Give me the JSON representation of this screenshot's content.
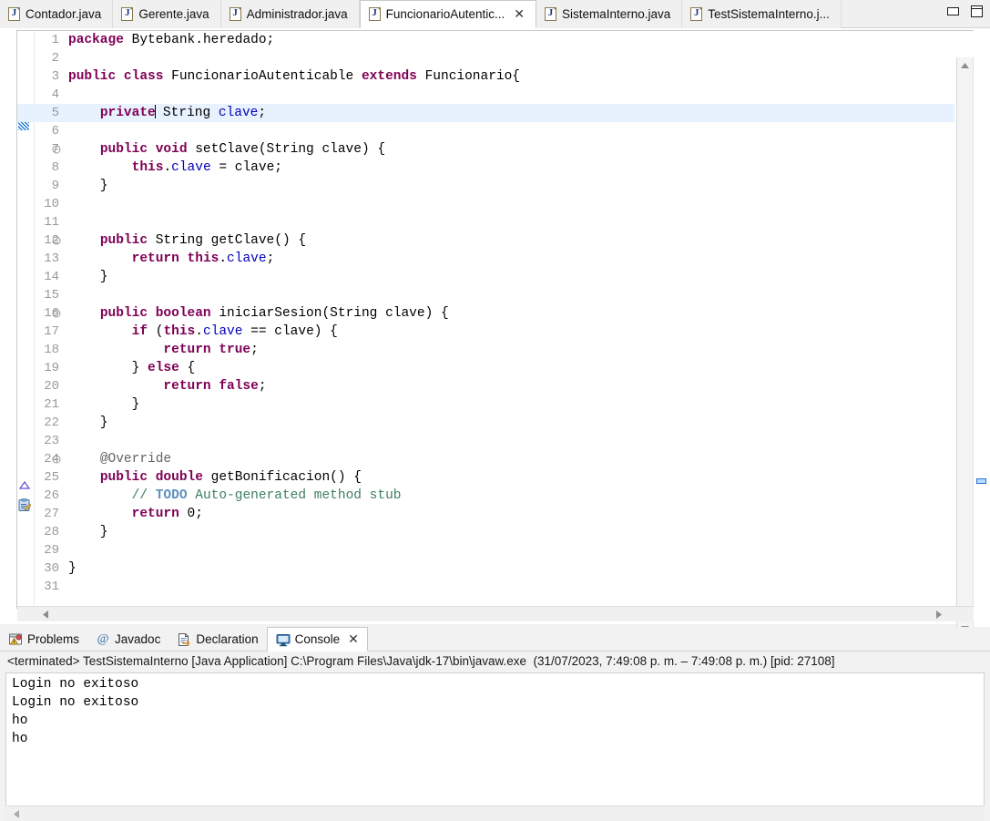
{
  "window": {
    "minimize_label": "minimize",
    "maximize_label": "maximize"
  },
  "editor_tabs": [
    {
      "label": "Contador.java",
      "icon": "java-file-icon",
      "active": false,
      "closable": false
    },
    {
      "label": "Gerente.java",
      "icon": "java-file-icon",
      "active": false,
      "closable": false
    },
    {
      "label": "Administrador.java",
      "icon": "java-file-icon",
      "active": false,
      "closable": false
    },
    {
      "label": "FuncionarioAutentic...",
      "icon": "java-file-icon",
      "active": true,
      "closable": true,
      "close_label": "✕"
    },
    {
      "label": "SistemaInterno.java",
      "icon": "java-file-icon",
      "active": false,
      "closable": false
    },
    {
      "label": "TestSistemaInterno.j...",
      "icon": "java-file-icon",
      "active": false,
      "closable": false
    }
  ],
  "editor": {
    "filename": "FuncionarioAutenticable.java",
    "language": "java",
    "cursor_line": 5,
    "highlighted_line": 5,
    "fold_lines": [
      7,
      12,
      16,
      24
    ],
    "override_marker_line": 25,
    "task_marker_line": 26,
    "changed_marker_line": 5,
    "lines": [
      {
        "n": "1",
        "tokens": [
          {
            "t": "package ",
            "c": "kw"
          },
          {
            "t": "Bytebank.heredado;",
            "c": "plain"
          }
        ]
      },
      {
        "n": "2",
        "tokens": []
      },
      {
        "n": "3",
        "tokens": [
          {
            "t": "public class ",
            "c": "kw"
          },
          {
            "t": "FuncionarioAutenticable ",
            "c": "plain"
          },
          {
            "t": "extends ",
            "c": "kw"
          },
          {
            "t": "Funcionario{",
            "c": "plain"
          }
        ]
      },
      {
        "n": "4",
        "tokens": []
      },
      {
        "n": "5",
        "tokens": [
          {
            "t": "    ",
            "c": "plain"
          },
          {
            "t": "private",
            "c": "kw"
          },
          {
            "t": "CARET",
            "c": "caret"
          },
          {
            "t": " String ",
            "c": "plain"
          },
          {
            "t": "clave",
            "c": "fld"
          },
          {
            "t": ";",
            "c": "plain"
          }
        ]
      },
      {
        "n": "6",
        "tokens": []
      },
      {
        "n": "7",
        "tokens": [
          {
            "t": "    ",
            "c": "plain"
          },
          {
            "t": "public void ",
            "c": "kw"
          },
          {
            "t": "setClave(String clave) {",
            "c": "plain"
          }
        ]
      },
      {
        "n": "8",
        "tokens": [
          {
            "t": "        ",
            "c": "plain"
          },
          {
            "t": "this",
            "c": "kw"
          },
          {
            "t": ".",
            "c": "plain"
          },
          {
            "t": "clave",
            "c": "fld"
          },
          {
            "t": " = clave;",
            "c": "plain"
          }
        ]
      },
      {
        "n": "9",
        "tokens": [
          {
            "t": "    }",
            "c": "plain"
          }
        ]
      },
      {
        "n": "10",
        "tokens": []
      },
      {
        "n": "11",
        "tokens": []
      },
      {
        "n": "12",
        "tokens": [
          {
            "t": "    ",
            "c": "plain"
          },
          {
            "t": "public ",
            "c": "kw"
          },
          {
            "t": "String getClave() {",
            "c": "plain"
          }
        ]
      },
      {
        "n": "13",
        "tokens": [
          {
            "t": "        ",
            "c": "plain"
          },
          {
            "t": "return this",
            "c": "kw"
          },
          {
            "t": ".",
            "c": "plain"
          },
          {
            "t": "clave",
            "c": "fld"
          },
          {
            "t": ";",
            "c": "plain"
          }
        ]
      },
      {
        "n": "14",
        "tokens": [
          {
            "t": "    }",
            "c": "plain"
          }
        ]
      },
      {
        "n": "15",
        "tokens": []
      },
      {
        "n": "16",
        "tokens": [
          {
            "t": "    ",
            "c": "plain"
          },
          {
            "t": "public boolean ",
            "c": "kw"
          },
          {
            "t": "iniciarSesion(String clave) {",
            "c": "plain"
          }
        ]
      },
      {
        "n": "17",
        "tokens": [
          {
            "t": "        ",
            "c": "plain"
          },
          {
            "t": "if",
            "c": "kw"
          },
          {
            "t": " (",
            "c": "plain"
          },
          {
            "t": "this",
            "c": "kw"
          },
          {
            "t": ".",
            "c": "plain"
          },
          {
            "t": "clave",
            "c": "fld"
          },
          {
            "t": " == clave) {",
            "c": "plain"
          }
        ]
      },
      {
        "n": "18",
        "tokens": [
          {
            "t": "            ",
            "c": "plain"
          },
          {
            "t": "return true",
            "c": "kw"
          },
          {
            "t": ";",
            "c": "plain"
          }
        ]
      },
      {
        "n": "19",
        "tokens": [
          {
            "t": "        } ",
            "c": "plain"
          },
          {
            "t": "else",
            "c": "kw"
          },
          {
            "t": " {",
            "c": "plain"
          }
        ]
      },
      {
        "n": "20",
        "tokens": [
          {
            "t": "            ",
            "c": "plain"
          },
          {
            "t": "return false",
            "c": "kw"
          },
          {
            "t": ";",
            "c": "plain"
          }
        ]
      },
      {
        "n": "21",
        "tokens": [
          {
            "t": "        }",
            "c": "plain"
          }
        ]
      },
      {
        "n": "22",
        "tokens": [
          {
            "t": "    }",
            "c": "plain"
          }
        ]
      },
      {
        "n": "23",
        "tokens": []
      },
      {
        "n": "24",
        "tokens": [
          {
            "t": "    ",
            "c": "plain"
          },
          {
            "t": "@Override",
            "c": "ann"
          }
        ]
      },
      {
        "n": "25",
        "tokens": [
          {
            "t": "    ",
            "c": "plain"
          },
          {
            "t": "public double ",
            "c": "kw"
          },
          {
            "t": "getBonificacion() {",
            "c": "plain"
          }
        ]
      },
      {
        "n": "26",
        "tokens": [
          {
            "t": "        ",
            "c": "plain"
          },
          {
            "t": "// ",
            "c": "cmt"
          },
          {
            "t": "TODO",
            "c": "todo"
          },
          {
            "t": " Auto-generated method stub",
            "c": "cmt"
          }
        ]
      },
      {
        "n": "27",
        "tokens": [
          {
            "t": "        ",
            "c": "plain"
          },
          {
            "t": "return ",
            "c": "kw"
          },
          {
            "t": "0;",
            "c": "plain"
          }
        ]
      },
      {
        "n": "28",
        "tokens": [
          {
            "t": "    }",
            "c": "plain"
          }
        ]
      },
      {
        "n": "29",
        "tokens": []
      },
      {
        "n": "30",
        "tokens": [
          {
            "t": "}",
            "c": "plain"
          }
        ]
      },
      {
        "n": "31",
        "tokens": []
      }
    ]
  },
  "bottom_tabs": [
    {
      "label": "Problems",
      "icon": "problems-icon",
      "active": false,
      "closable": false
    },
    {
      "label": "Javadoc",
      "icon": "javadoc-at-icon",
      "active": false,
      "closable": false
    },
    {
      "label": "Declaration",
      "icon": "declaration-icon",
      "active": false,
      "closable": false
    },
    {
      "label": "Console",
      "icon": "console-monitor-icon",
      "active": true,
      "closable": true,
      "close_label": "✕"
    }
  ],
  "console": {
    "terminated_line": "<terminated> TestSistemaInterno [Java Application] C:\\Program Files\\Java\\jdk-17\\bin\\javaw.exe  (31/07/2023, 7:49:08 p. m. – 7:49:08 p. m.) [pid: 27108]",
    "output": [
      "Login no exitoso",
      "Login no exitoso",
      "ho",
      "ho"
    ]
  },
  "colors": {
    "keyword": "#7F0055",
    "field": "#0000C0",
    "comment": "#3F7F5F",
    "todo": "#5F8FBF",
    "annotation": "#646464",
    "line_highlight": "#E8F2FE",
    "tab_active_bg": "#FFFFFF",
    "chrome_bg": "#F0F0F0"
  }
}
